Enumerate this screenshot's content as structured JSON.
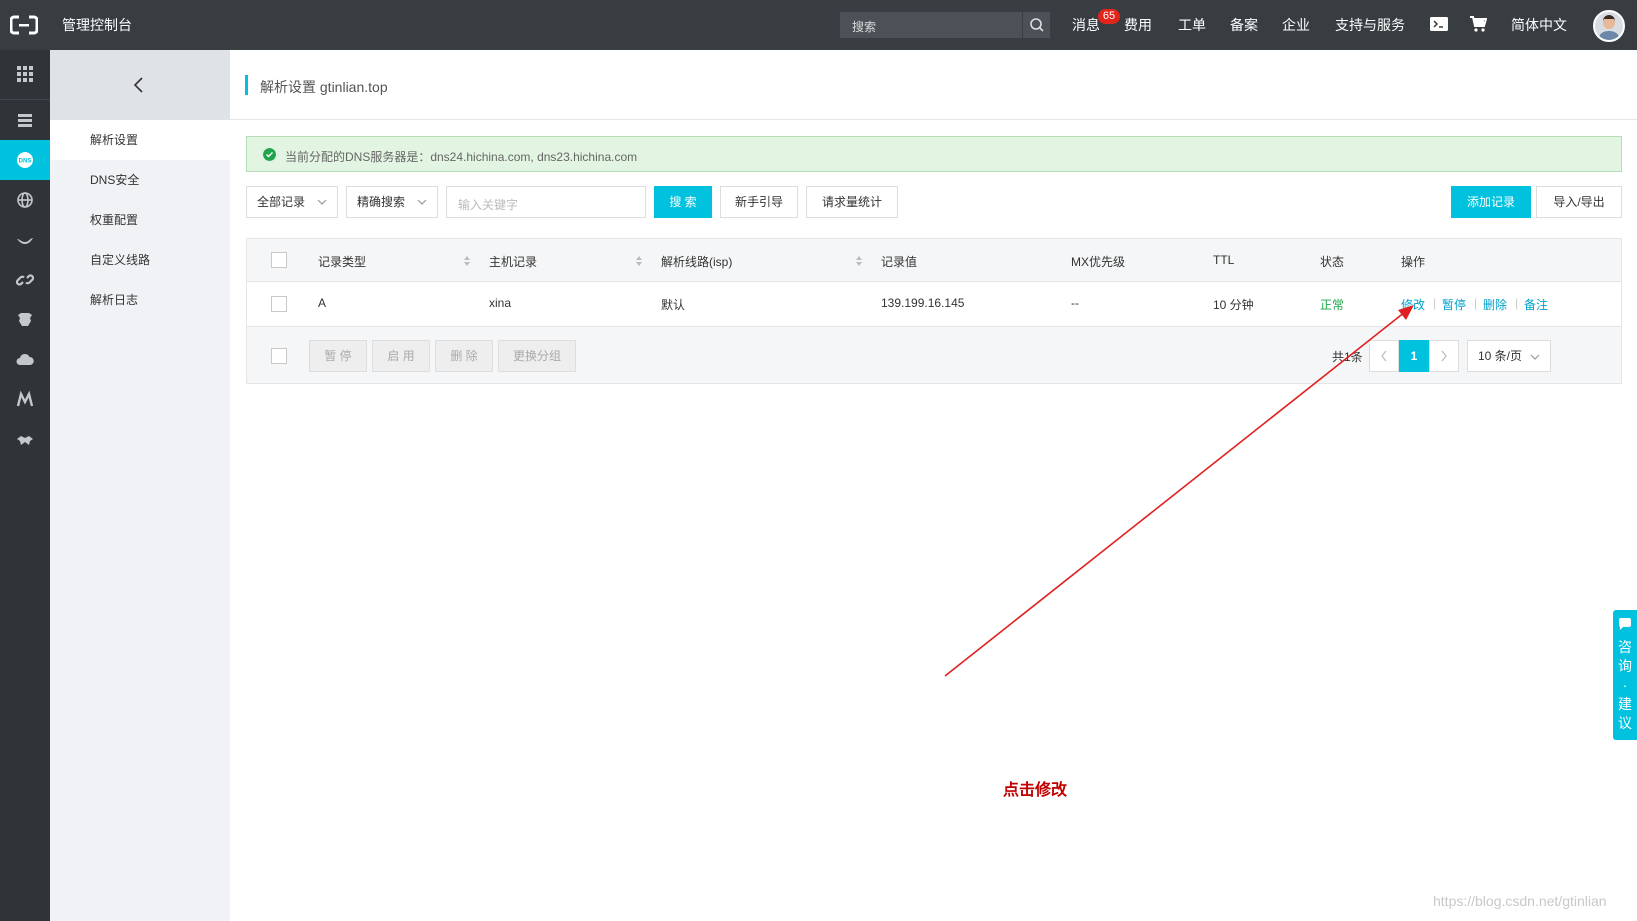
{
  "topbar": {
    "console_title": "管理控制台",
    "search_placeholder": "搜索",
    "nav": [
      "消息",
      "费用",
      "工单",
      "备案",
      "企业",
      "支持与服务",
      "简体中文"
    ],
    "message_badge": "65"
  },
  "rail": {
    "icons": [
      "grid-icon",
      "server-icon",
      "dns-icon",
      "globe-icon",
      "bird-icon",
      "link-icon",
      "shield-icon",
      "cloud-icon",
      "m-logo-icon",
      "handshake-icon"
    ],
    "active_index": 2
  },
  "sidebar": {
    "items": [
      {
        "label": "解析设置",
        "active": true
      },
      {
        "label": "DNS安全",
        "active": false
      },
      {
        "label": "权重配置",
        "active": false
      },
      {
        "label": "自定义线路",
        "active": false
      },
      {
        "label": "解析日志",
        "active": false
      }
    ]
  },
  "page": {
    "title": "解析设置 gtinlian.top",
    "alert": "当前分配的DNS服务器是：dns24.hichina.com, dns23.hichina.com"
  },
  "toolbar": {
    "filter_all": "全部记录",
    "filter_precise": "精确搜索",
    "keyword_placeholder": "输入关键字",
    "search_button": "搜 索",
    "guide_button": "新手引导",
    "stats_button": "请求量统计",
    "add_button": "添加记录",
    "import_export_button": "导入/导出"
  },
  "table": {
    "headers": {
      "type": "记录类型",
      "host": "主机记录",
      "line": "解析线路(isp)",
      "value": "记录值",
      "mx": "MX优先级",
      "ttl": "TTL",
      "status": "状态",
      "ops": "操作"
    },
    "rows": [
      {
        "type": "A",
        "host": "xina",
        "line": "默认",
        "value": "139.199.16.145",
        "mx": "--",
        "ttl": "10 分钟",
        "status": "正常",
        "ops": [
          "修改",
          "暂停",
          "删除",
          "备注"
        ]
      }
    ]
  },
  "footer": {
    "bulk": [
      "暂 停",
      "启 用",
      "删 除",
      "更换分组"
    ],
    "total": "共1条",
    "current_page": "1",
    "page_size": "10 条/页"
  },
  "annotation": {
    "text": "点击修改",
    "color": "#c00000"
  },
  "float_panel": {
    "text": "咨询·建议"
  },
  "watermark": "https://blog.csdn.net/gtinlian",
  "colors": {
    "accent": "#00c1de",
    "topbar": "#373d41",
    "rail": "#2f3438",
    "success": "#1fa44b",
    "link": "#00a2ca"
  }
}
